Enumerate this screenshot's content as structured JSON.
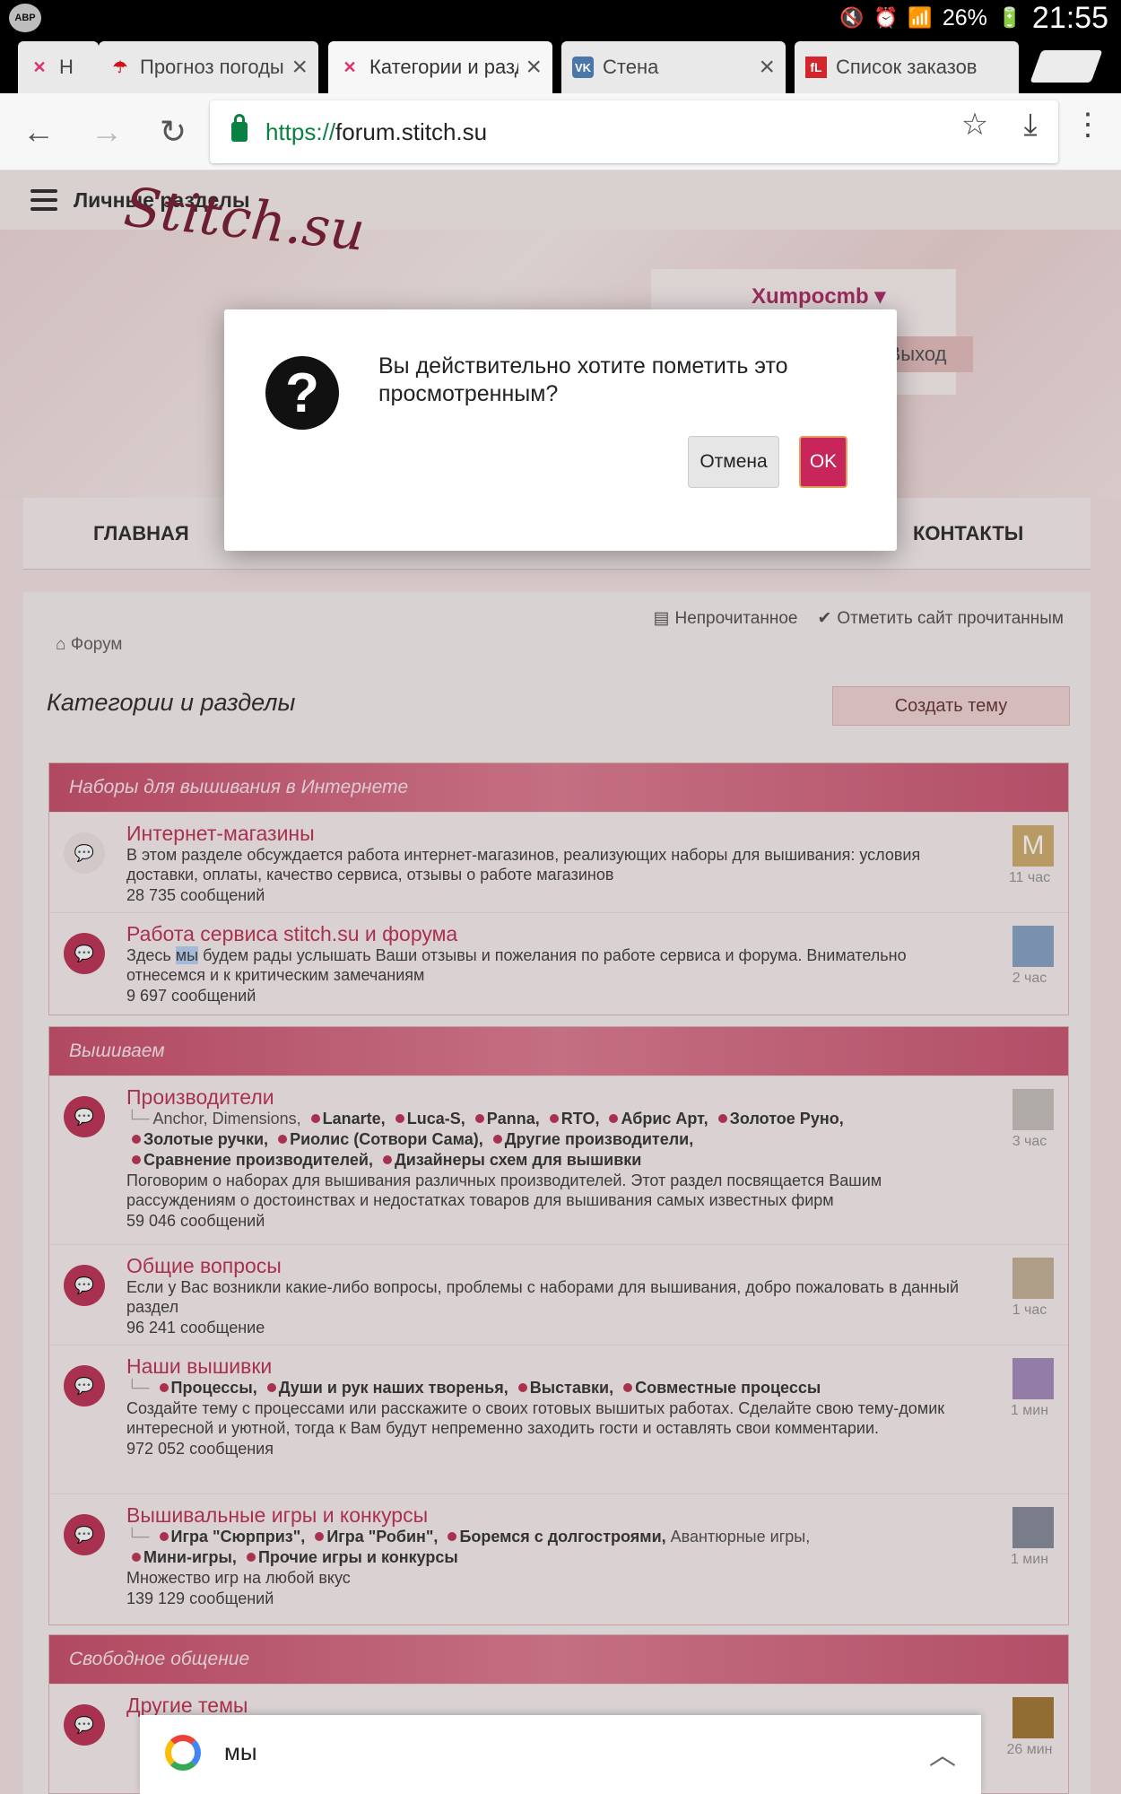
{
  "status": {
    "abp_label": "ABP",
    "battery": "26%",
    "time": "21:55"
  },
  "tabs": [
    {
      "title": "Н",
      "favicon": "stitch-icon"
    },
    {
      "title": "Прогноз погоды",
      "favicon": "umbrella-icon"
    },
    {
      "title": "Категории и разделы",
      "favicon": "stitch-icon",
      "active": true
    },
    {
      "title": "Стена",
      "favicon": "vk-icon"
    },
    {
      "title": "Список заказов",
      "favicon": "fl-icon"
    }
  ],
  "address": {
    "scheme": "https://",
    "host": "forum.stitch.su"
  },
  "page": {
    "topbar_label": "Личные разделы",
    "logo_text": "Stitch.su",
    "username": "Xumpocmb ▾",
    "logout_label": "Выход",
    "nav": [
      "ГЛАВНАЯ",
      "КОНТАКТЫ"
    ],
    "actions": [
      "Непрочитанное",
      "Отметить сайт прочитанным"
    ],
    "breadcrumb": "Форум",
    "title": "Категории и разделы",
    "create_topic": "Создать тему"
  },
  "categories": [
    {
      "name": "Наборы для вышивания в Интернете",
      "forums": [
        {
          "title": "Интернет-магазины",
          "desc": "В этом разделе обсуждается работа интернет-магазинов, реализующих наборы для вышивания: условия доставки, оплаты, качество сервиса, отзывы о работе магазинов",
          "count": "28 735 сообщений",
          "when": "11 час",
          "avatar_letter": "M"
        },
        {
          "title": "Работа сервиса stitch.su и форума",
          "desc_pre": "Здесь ",
          "desc_hl": "мы",
          "desc_post": " будем рады услышать Ваши отзывы и пожелания по работе сервиса и форума. Внимательно отнесемся и к критическим замечаниям",
          "count": "9 697 сообщений",
          "when": "2 час"
        }
      ]
    },
    {
      "name": "Вышиваем",
      "forums": [
        {
          "title": "Производители",
          "subs_plain": [
            "Anchor,",
            "Dimensions,"
          ],
          "subs_bold_1": [
            "Lanarte,",
            "Luca-S,",
            "Panna,",
            "RTO,",
            "Абрис Арт,",
            "Золотое Руно,"
          ],
          "subs_bold_2": [
            "Золотые ручки,",
            "Риолис (Сотвори Сама),",
            "Другие производители,"
          ],
          "subs_bold_3": [
            "Сравнение производителей,",
            "Дизайнеры схем для вышивки"
          ],
          "desc": "Поговорим о наборах для вышивания различных производителей. Этот раздел посвящается Вашим рассуждениям о достоинствах и недостатках товаров для вышивания самых известных фирм",
          "count": "59 046 сообщений",
          "when": "3 час"
        },
        {
          "title": "Общие вопросы",
          "desc": "Если у Вас возникли какие-либо вопросы, проблемы с наборами для вышивания, добро пожаловать в данный раздел",
          "count": "96 241 сообщение",
          "when": "1 час"
        },
        {
          "title": "Наши вышивки",
          "subs_bold_1": [
            "Процессы,",
            "Души и рук наших творенья,",
            "Выставки,",
            "Совместные процессы"
          ],
          "desc": "Создайте тему с процессами или расскажите о своих готовых вышитых работах. Сделайте свою тему-домик интересной и уютной, тогда к Вам будут непременно заходить гости и оставлять свои комментарии.",
          "count": "972 052 сообщения",
          "when": "1 мин"
        },
        {
          "title": "Вышивальные игры и конкурсы",
          "subs_bold_1": [
            "Игра \"Сюрприз\",",
            "Игра \"Робин\",",
            "Боремся с долгостроями,"
          ],
          "subs_plain_after": "Авантюрные игры,",
          "subs_bold_2": [
            "Мини-игры,",
            "Прочие игры и конкурсы"
          ],
          "desc": "Множество игр на любой вкус",
          "count": "139 129 сообщений",
          "when": "1 мин"
        }
      ]
    },
    {
      "name": "Свободное общение",
      "forums": [
        {
          "title": "Другие темы",
          "when": "26 мин"
        }
      ]
    }
  ],
  "dialog": {
    "message": "Вы действительно хотите пометить это просмотренным?",
    "cancel": "Отмена",
    "ok": "OK"
  },
  "google_bar": {
    "query": "мы"
  },
  "colors": {
    "accent": "#c0385a",
    "ok_button": "#c8265a",
    "secure_green": "#0b8043"
  }
}
